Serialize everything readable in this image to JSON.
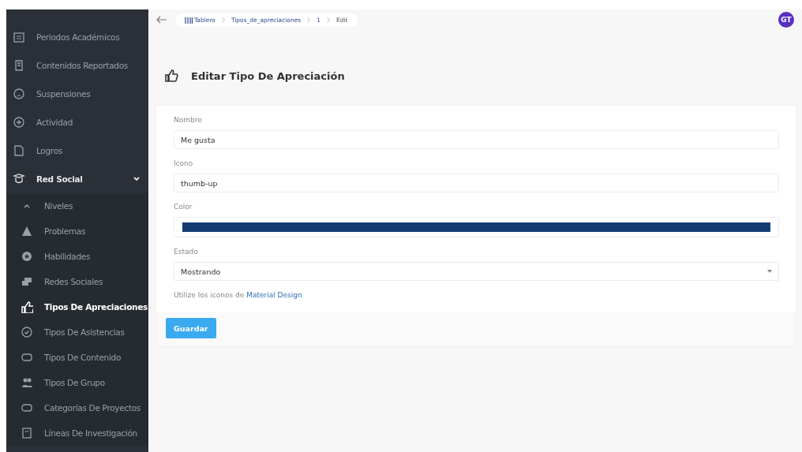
{
  "sidebar": {
    "items": [
      {
        "label": "Periodos Académicos",
        "selected": false
      },
      {
        "label": "Contenidos Reportados",
        "selected": false
      },
      {
        "label": "Suspensiones",
        "selected": false
      },
      {
        "label": "Actividad",
        "selected": false
      },
      {
        "label": "Logros",
        "selected": false
      },
      {
        "label": "Red Social",
        "selected": false,
        "expanded": true,
        "children": [
          {
            "label": "Niveles",
            "selected": false
          },
          {
            "label": "Problemas",
            "selected": false
          },
          {
            "label": "Habilidades",
            "selected": false
          },
          {
            "label": "Redes Sociales",
            "selected": false
          },
          {
            "label": "Tipos De Apreciaciones",
            "selected": true
          },
          {
            "label": "Tipos De Asistencias",
            "selected": false
          },
          {
            "label": "Tipos De Contenido",
            "selected": false
          },
          {
            "label": "Tipos De Grupo",
            "selected": false
          },
          {
            "label": "Categorías De Proyectos",
            "selected": false
          },
          {
            "label": "Líneas De Investigación",
            "selected": false
          }
        ]
      }
    ]
  },
  "breadcrumb": [
    "Tablero",
    "Tipos_de_apreciaciones",
    "1",
    "Edit"
  ],
  "user": {
    "initials": "GT"
  },
  "page_title": "Editar Tipo De Apreciación",
  "form": {
    "fields": [
      {
        "kind": "text",
        "label": "Nombre",
        "value": "Me gusta"
      },
      {
        "kind": "text",
        "label": "Icono",
        "value": "thumb-up"
      },
      {
        "kind": "color",
        "label": "Color",
        "color": "#163c75"
      },
      {
        "kind": "select",
        "label": "Estado",
        "value": "Mostrando"
      }
    ],
    "hint": {
      "text": "Utilize los iconos de ",
      "link": "Material Design"
    },
    "submit": "Guardar"
  }
}
